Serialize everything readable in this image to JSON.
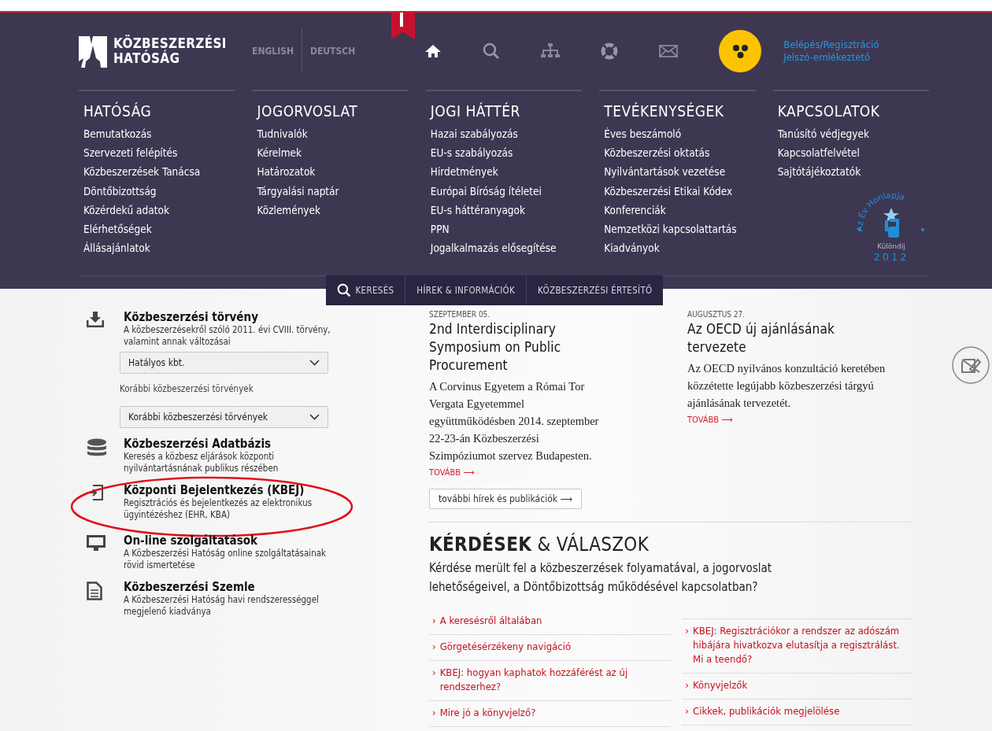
{
  "logo": {
    "line1": "KÖZBESZERZÉSI",
    "line2": "HATÓSÁG"
  },
  "languages": [
    "ENGLISH",
    "DEUTSCH"
  ],
  "login": {
    "login": "Belépés",
    "separator": "/",
    "register": "Regisztráció",
    "reminder": "Jelszó-emlékeztető"
  },
  "menu": [
    {
      "title": "HATÓSÁG",
      "items": [
        "Bemutatkozás",
        "Szervezeti felépítés",
        "Közbeszerzések Tanácsa",
        "Döntőbizottság",
        "Közérdekű adatok",
        "Elérhetőségek",
        "Állásajánlatok"
      ]
    },
    {
      "title": "JOGORVOSLAT",
      "items": [
        "Tudnivalók",
        "Kérelmek",
        "Határozatok",
        "Tárgyalási naptár",
        "Közlemények"
      ]
    },
    {
      "title": "JOGI HÁTTÉR",
      "items": [
        "Hazai szabályozás",
        "EU-s szabályozás",
        "Hirdetmények",
        "Európai Bíróság ítéletei",
        "EU-s háttéranyagok",
        "PPN",
        "Jogalkalmazás elősegítése"
      ]
    },
    {
      "title": "TEVÉKENYSÉGEK",
      "items": [
        "Éves beszámoló",
        "Közbeszerzési oktatás",
        "Nyilvántartások vezetése",
        "Közbeszerzési Etikai Kódex",
        "Konferenciák",
        "Nemzetközi kapcsolattartás",
        "Kiadványok"
      ]
    },
    {
      "title": "KAPCSOLATOK",
      "items": [
        "Tanúsító védjegyek",
        "Kapcsolatfelvétel",
        "Sajtótájékoztatók"
      ]
    }
  ],
  "award": {
    "arc": "Az Év Honlapja",
    "label": "Különdíj",
    "year": "2012"
  },
  "tabs": [
    {
      "label": "KERESÉS",
      "kind": "search"
    },
    {
      "label": "HÍREK & INFORMÁCIÓK",
      "kind": "plain"
    },
    {
      "label": "KÖZBESZERZÉSI ÉRTESÍTŐ",
      "kind": "plain"
    }
  ],
  "services": [
    {
      "kind": "download",
      "title": "Közbeszerzési törvény",
      "desc": "A közbeszerzésekről szóló 2011. évi CVIII. törvény, valamint annak változásai",
      "selects": [
        {
          "value": "Hatályos kbt."
        },
        {
          "label": "Korábbi közbeszerzési törvények",
          "value": "Korábbi közbeszerzési törvények"
        }
      ],
      "circled": false
    },
    {
      "kind": "database",
      "title": "Közbeszerzési Adatbázis",
      "desc": "Keresés a közbesz eljárások központi nyilvántartásnának publikus részében",
      "circled": false
    },
    {
      "kind": "login",
      "title": "Központi Bejelentkezés (KBEJ)",
      "desc": "Regisztrációs és bejelentkezés az elektronikus ügyintézéshez (EHR, KBA)",
      "circled": true
    },
    {
      "kind": "monitor",
      "title": "On-line szolgáltatások",
      "desc": "A Közbeszerzési Hatóság online szolgáltatásainak rövid ismertetése",
      "circled": false
    },
    {
      "kind": "document",
      "title": "Közbeszerzési Szemle",
      "desc": "A Közbeszerzési Hatóság havi rendszerességgel megjelenő kiadványa",
      "circled": false
    }
  ],
  "news": [
    {
      "date": "SZEPTEMBER 05.",
      "title": "2nd Interdisciplinary Symposium on Public Procurement",
      "body": "A Corvinus Egyetem a Római Tor Vergata Egyetemmel együttműködésben 2014. szeptember 22-23-án Közbeszerzési Szimpóziumot szervez Budapesten.",
      "more": "TOVÁBB ⟶"
    },
    {
      "date": "AUGUSZTUS 27.",
      "title": "Az OECD új ajánlásának tervezete",
      "body": "Az OECD nyilvános konzultáció keretében közzétette legújabb közbeszerzési tárgyú ajánlásának tervezetét.",
      "more": "TOVÁBB ⟶"
    }
  ],
  "more_news": "további hírek és publikációk ⟶",
  "faq": {
    "heading": "**KÉRDÉSEK** & VÁLASZOK",
    "intro": "Kérdése merült fel a közbeszerzések folyamatával, a jogorvoslat lehetőségeivel, a Döntőbizottság működésével kapcsolatban?",
    "bullet": "›",
    "left": [
      "A keresésről általában",
      "Görgetésérzékeny navigáció",
      "KBEJ: hogyan kaphatok hozzáférést az új rendszerhez?",
      "Mire jó a könyvjelző?"
    ],
    "right": [
      "KBEJ: Regisztrációkor a rendszer az adószám hibájára hivatkozva elutasítja a regisztrálást. Mi a teendő?",
      "Könyvjelzők",
      "Cikkek, publikációk megjelölése"
    ]
  }
}
